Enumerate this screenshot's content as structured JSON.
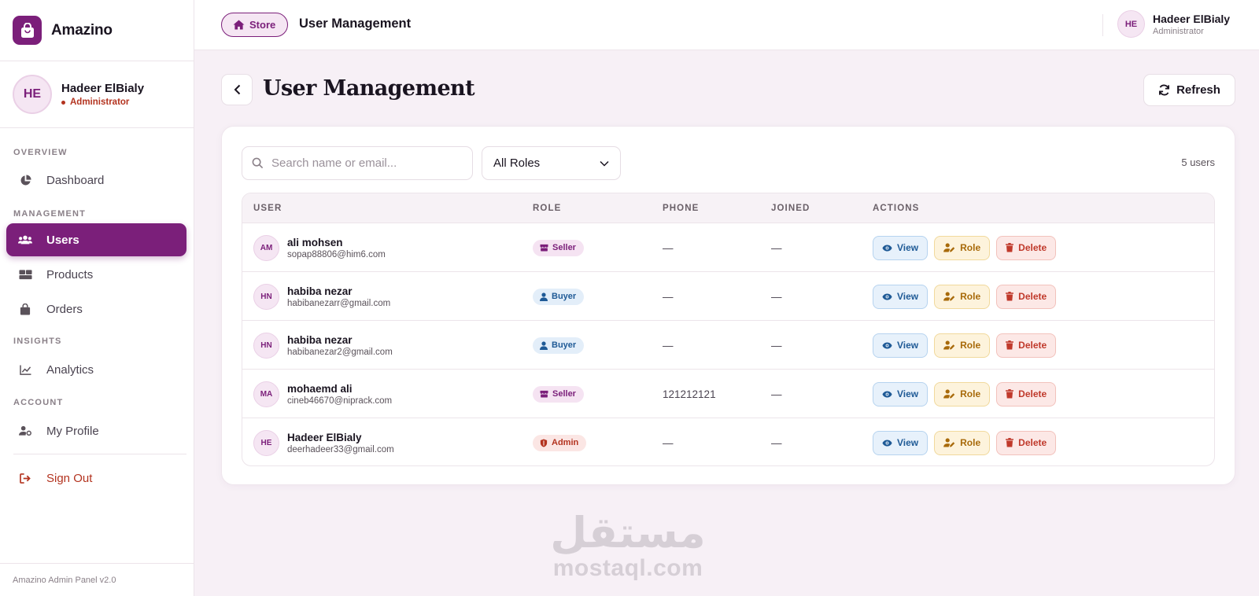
{
  "brand": {
    "name": "Amazino"
  },
  "sidebar": {
    "profile": {
      "initials": "HE",
      "name": "Hadeer ElBialy",
      "role": "Administrator"
    },
    "sections": {
      "overview": "OVERVIEW",
      "management": "MANAGEMENT",
      "insights": "INSIGHTS",
      "account": "ACCOUNT"
    },
    "items": {
      "dashboard": "Dashboard",
      "users": "Users",
      "products": "Products",
      "orders": "Orders",
      "analytics": "Analytics",
      "profile": "My Profile",
      "signout": "Sign Out"
    },
    "footer": "Amazino Admin Panel v2.0"
  },
  "topbar": {
    "store_label": "Store",
    "title": "User Management",
    "user": {
      "initials": "HE",
      "name": "Hadeer ElBialy",
      "role": "Administrator"
    }
  },
  "page": {
    "title": "User Management",
    "refresh_label": "Refresh"
  },
  "filters": {
    "search_placeholder": "Search name or email...",
    "role_selected": "All Roles",
    "count": "5 users"
  },
  "table": {
    "columns": {
      "user": "USER",
      "role": "ROLE",
      "phone": "PHONE",
      "joined": "JOINED",
      "actions": "ACTIONS"
    },
    "action_labels": {
      "view": "View",
      "role": "Role",
      "delete": "Delete"
    },
    "rows": [
      {
        "initials": "AM",
        "name": "ali mohsen",
        "email": "sopap88806@him6.com",
        "role": "Seller",
        "phone": "—",
        "joined": "—"
      },
      {
        "initials": "HN",
        "name": "habiba nezar",
        "email": "habibanezarr@gmail.com",
        "role": "Buyer",
        "phone": "—",
        "joined": "—"
      },
      {
        "initials": "HN",
        "name": "habiba nezar",
        "email": "habibanezar2@gmail.com",
        "role": "Buyer",
        "phone": "—",
        "joined": "—"
      },
      {
        "initials": "MA",
        "name": "mohaemd ali",
        "email": "cineb46670@niprack.com",
        "role": "Seller",
        "phone": "121212121",
        "joined": "—"
      },
      {
        "initials": "HE",
        "name": "Hadeer ElBialy",
        "email": "deerhadeer33@gmail.com",
        "role": "Admin",
        "phone": "—",
        "joined": "—"
      }
    ]
  },
  "watermark": {
    "logo_text": "مستقل",
    "text": "mostaql.com"
  },
  "colors": {
    "primary": "#7b1f7a",
    "danger": "#b3331f",
    "background": "#f7f0f6"
  }
}
